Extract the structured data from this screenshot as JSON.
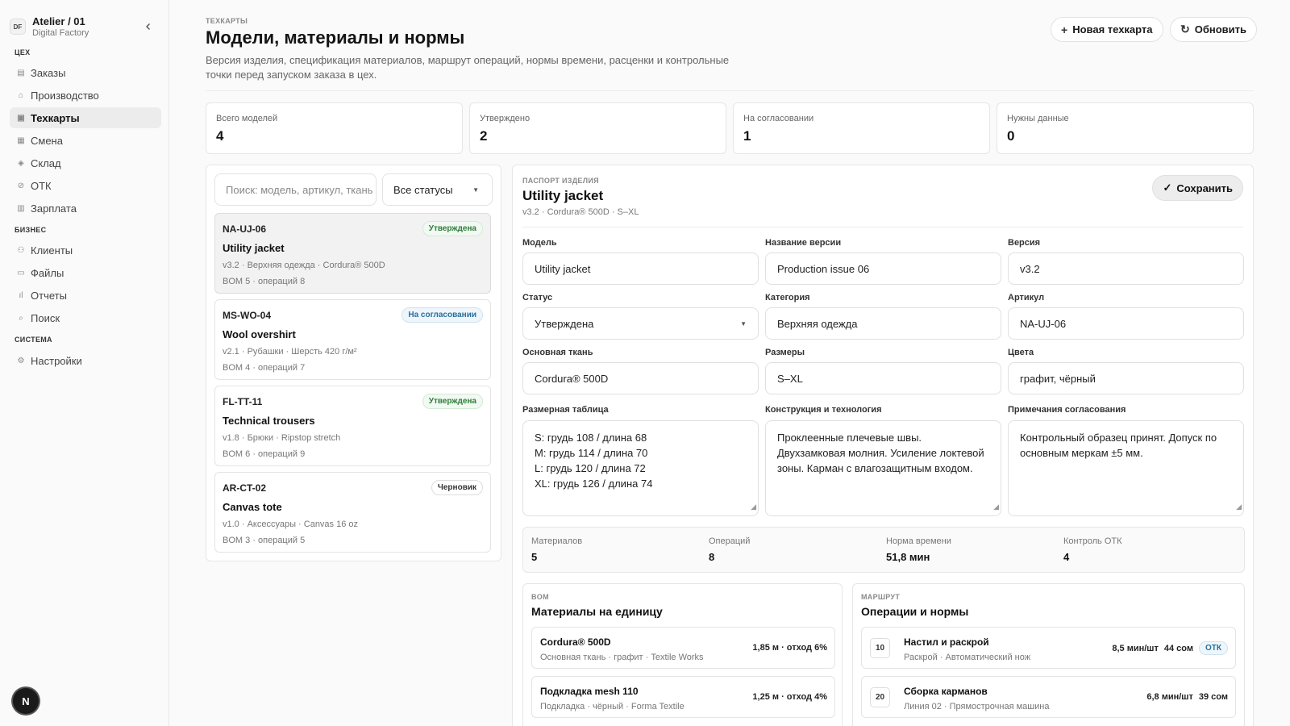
{
  "sidebar": {
    "brand_badge": "DF",
    "brand_title": "Atelier / 01",
    "brand_sub": "Digital Factory",
    "sections": [
      {
        "label": "ЦЕХ",
        "items": [
          "Заказы",
          "Производство",
          "Техкарты",
          "Смена",
          "Склад",
          "ОТК",
          "Зарплата"
        ]
      },
      {
        "label": "БИЗНЕС",
        "items": [
          "Клиенты",
          "Файлы",
          "Отчеты",
          "Поиск"
        ]
      },
      {
        "label": "СИСТЕМА",
        "items": [
          "Настройки"
        ]
      }
    ],
    "active_item": "Техкарты",
    "fab_label": "N"
  },
  "header": {
    "eyebrow": "ТЕХКАРТЫ",
    "title": "Модели, материалы и нормы",
    "description": "Версия изделия, спецификация материалов, маршрут операций, нормы времени, расценки и контрольные точки перед запуском заказа в цех.",
    "new_button": "Новая техкарта",
    "refresh_button": "Обновить"
  },
  "stats": [
    {
      "label": "Всего моделей",
      "value": "4"
    },
    {
      "label": "Утверждено",
      "value": "2"
    },
    {
      "label": "На согласовании",
      "value": "1"
    },
    {
      "label": "Нужны данные",
      "value": "0"
    }
  ],
  "list": {
    "search_placeholder": "Поиск: модель, артикул, ткань",
    "filter_value": "Все статусы",
    "cards": [
      {
        "code": "NA-UJ-06",
        "name": "Utility jacket",
        "meta": "v3.2 · Верхняя одежда · Cordura® 500D",
        "meta2": "BOM 5 · операций 8",
        "status": "Утверждена"
      },
      {
        "code": "MS-WO-04",
        "name": "Wool overshirt",
        "meta": "v2.1 · Рубашки · Шерсть 420 г/м²",
        "meta2": "BOM 4 · операций 7",
        "status": "На согласовании"
      },
      {
        "code": "FL-TT-11",
        "name": "Technical trousers",
        "meta": "v1.8 · Брюки · Ripstop stretch",
        "meta2": "BOM 6 · операций 9",
        "status": "Утверждена"
      },
      {
        "code": "AR-CT-02",
        "name": "Canvas tote",
        "meta": "v1.0 · Аксессуары · Canvas 16 oz",
        "meta2": "BOM 3 · операций 5",
        "status": "Черновик"
      }
    ]
  },
  "detail": {
    "eyebrow": "ПАСПОРТ ИЗДЕЛИЯ",
    "title": "Utility jacket",
    "subtitle": "v3.2 · Cordura® 500D · S–XL",
    "save_button": "Сохранить",
    "fields": {
      "model": {
        "label": "Модель",
        "value": "Utility jacket"
      },
      "version_name": {
        "label": "Название версии",
        "value": "Production issue 06"
      },
      "version": {
        "label": "Версия",
        "value": "v3.2"
      },
      "status": {
        "label": "Статус",
        "value": "Утверждена"
      },
      "category": {
        "label": "Категория",
        "value": "Верхняя одежда"
      },
      "article": {
        "label": "Артикул",
        "value": "NA-UJ-06"
      },
      "fabric": {
        "label": "Основная ткань",
        "value": "Cordura® 500D"
      },
      "sizes": {
        "label": "Размеры",
        "value": "S–XL"
      },
      "colors": {
        "label": "Цвета",
        "value": "графит, чёрный"
      },
      "size_table": {
        "label": "Размерная таблица",
        "lines": [
          "S: грудь 108 / длина 68",
          "M: грудь 114 / длина 70",
          "L: грудь 120 / длина 72",
          "XL: грудь 126 / длина 74"
        ]
      },
      "construction": {
        "label": "Конструкция и технология",
        "value": "Проклеенные плечевые швы. Двухзамковая молния. Усиление локтевой зоны. Карман с влагозащитным входом."
      },
      "notes": {
        "label": "Примечания согласования",
        "value": "Контрольный образец принят. Допуск по основным меркам ±5 мм."
      }
    },
    "summary": [
      {
        "label": "Материалов",
        "value": "5"
      },
      {
        "label": "Операций",
        "value": "8"
      },
      {
        "label": "Норма времени",
        "value": "51,8 мин"
      },
      {
        "label": "Контроль ОТК",
        "value": "4"
      }
    ],
    "bom": {
      "eyebrow": "BOM",
      "title": "Материалы на единицу",
      "rows": [
        {
          "name": "Cordura® 500D",
          "meta": "Основная ткань · графит · Textile Works",
          "qty": "1,85 м · отход 6%"
        },
        {
          "name": "Подкладка mesh 110",
          "meta": "Подкладка · чёрный · Forma Textile",
          "qty": "1,25 м · отход 4%"
        }
      ]
    },
    "route": {
      "eyebrow": "МАРШРУТ",
      "title": "Операции и нормы",
      "rows": [
        {
          "num": "10",
          "name": "Настил и раскрой",
          "meta": "Раскрой · Автоматический нож",
          "time": "8,5 мин/шт",
          "rate": "44 сом",
          "tag": "ОТК"
        },
        {
          "num": "20",
          "name": "Сборка карманов",
          "meta": "Линия 02 · Прямострочная машина",
          "time": "6,8 мин/шт",
          "rate": "39 сом",
          "tag": ""
        }
      ]
    }
  },
  "colors": {
    "accent_ok": "#2f7d3b",
    "accent_pending": "#2a6f9b",
    "active_bg": "#ececec"
  }
}
